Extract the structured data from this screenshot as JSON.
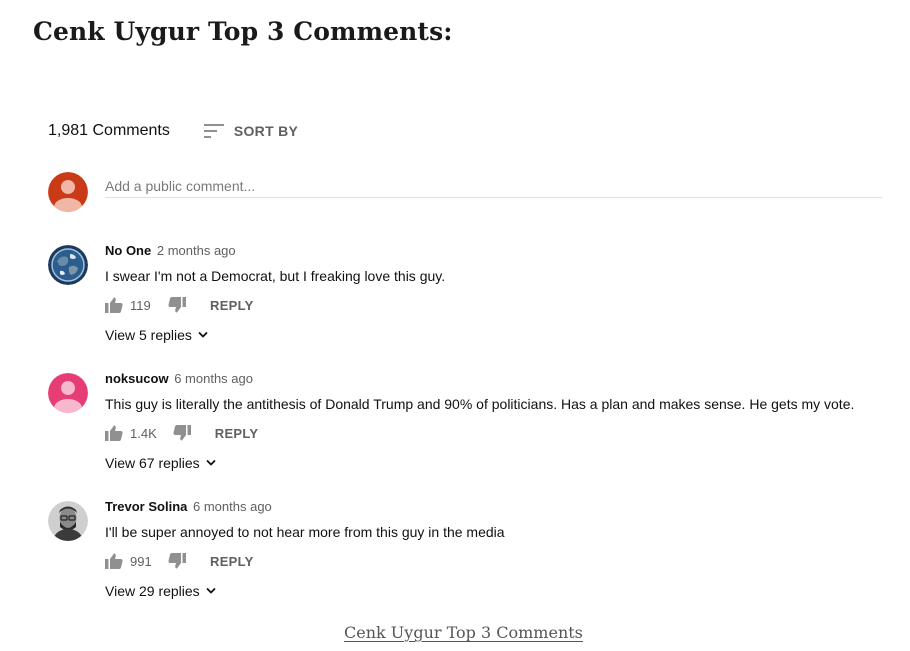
{
  "heading": "Cenk Uygur Top 3 Comments:",
  "comments_header": {
    "count_label": "1,981 Comments",
    "sort_label": "SORT BY",
    "sort_icon": "sort-icon"
  },
  "add_comment": {
    "placeholder": "Add a public comment...",
    "avatar_color": "#c93a17"
  },
  "comments": [
    {
      "author": "No One",
      "time": "2 months ago",
      "text": "I swear I'm not a Democrat, but I freaking love this guy.",
      "likes": "119",
      "reply_label": "REPLY",
      "view_replies": "View 5 replies",
      "avatar": "earth-avatar"
    },
    {
      "author": "noksucow",
      "time": "6 months ago",
      "text": "This guy is literally the antithesis of Donald Trump and 90% of politicians. Has a plan and makes sense. He gets my vote.",
      "likes": "1.4K",
      "reply_label": "REPLY",
      "view_replies": "View 67 replies",
      "avatar": "default-avatar",
      "avatar_color": "#e53d74"
    },
    {
      "author": "Trevor Solina",
      "time": "6 months ago",
      "text": "I'll be super annoyed to not hear more from this guy in the media",
      "likes": "991",
      "reply_label": "REPLY",
      "view_replies": "View 29 replies",
      "avatar": "photo-avatar"
    }
  ],
  "footer_link": "Cenk Uygur Top 3 Comments",
  "colors": {
    "muted_text": "#606060",
    "divider": "#e0e0e0",
    "icon": "#909090"
  }
}
